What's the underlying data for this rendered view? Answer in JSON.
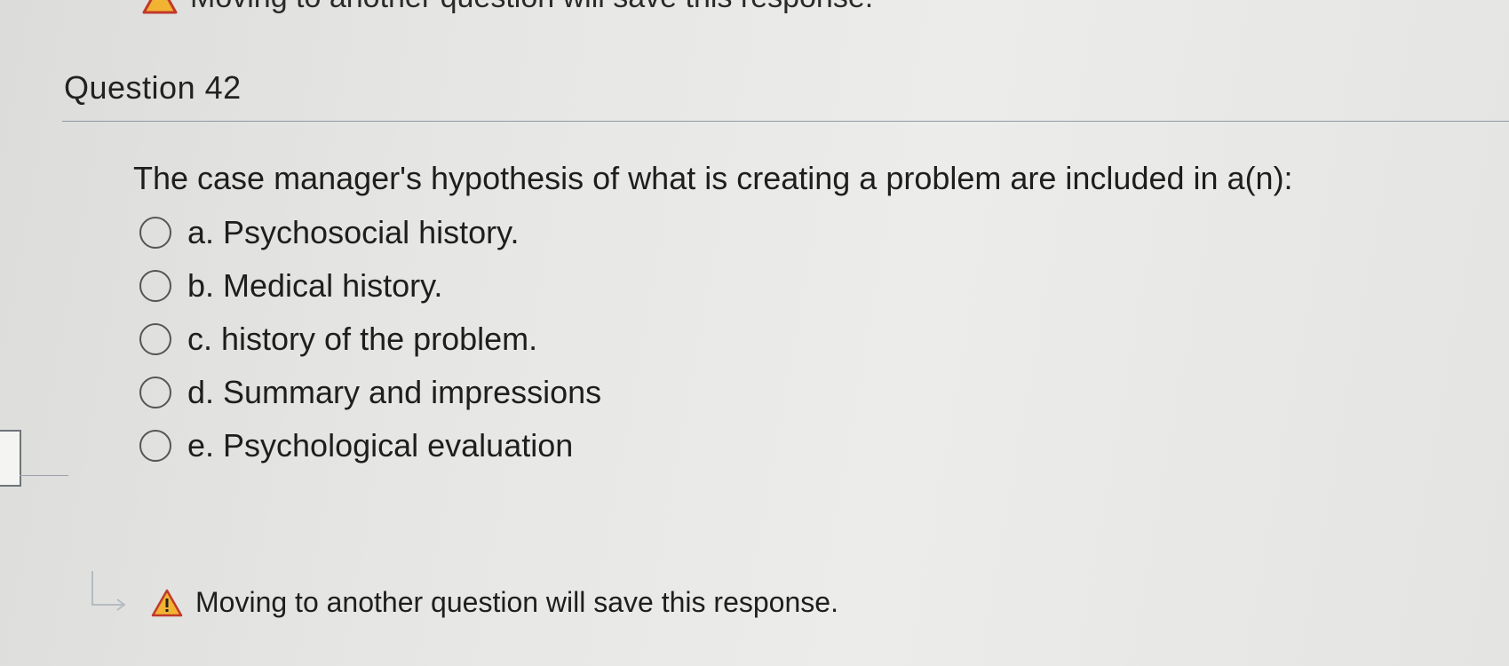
{
  "top_banner": {
    "icon": "warning-icon",
    "text": "Moving to another question will save this response."
  },
  "question": {
    "title": "Question 42",
    "text": "The case manager's hypothesis of what is creating a problem are included in a(n):",
    "options": [
      {
        "label": "a. Psychosocial history."
      },
      {
        "label": "b. Medical history."
      },
      {
        "label": "c. history of the problem."
      },
      {
        "label": "d. Summary and impressions"
      },
      {
        "label": "e. Psychological evaluation"
      }
    ]
  },
  "save_note": {
    "arrow_icon": "corner-down-right-arrow-icon",
    "icon": "warning-icon",
    "text": "Moving to another question will save this response."
  },
  "colors": {
    "warning_fill": "#f2b232",
    "warning_stroke": "#c0392b",
    "divider": "#8f9aa3"
  }
}
